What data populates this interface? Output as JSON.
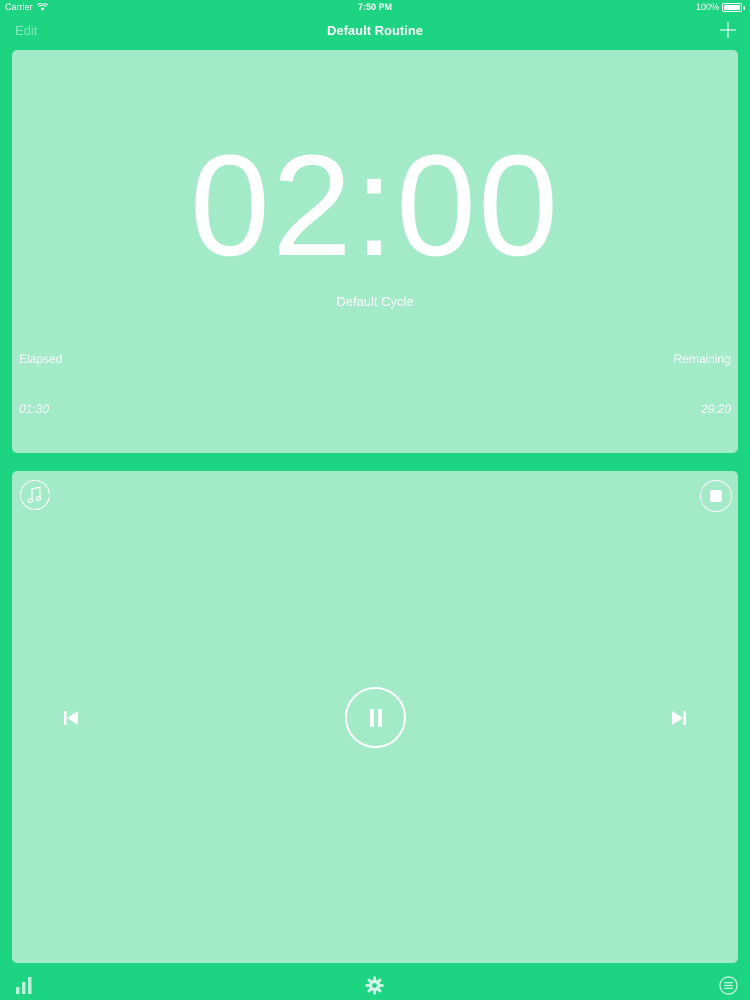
{
  "status_bar": {
    "carrier": "Carrier",
    "time": "7:50 PM",
    "battery": "100%"
  },
  "nav": {
    "edit_label": "Edit",
    "title": "Default Routine"
  },
  "timer": {
    "time": "02:00",
    "cycle_name": "Default Cycle",
    "elapsed_label": "Elapsed",
    "remaining_label": "Remaining",
    "elapsed_value": "01:30",
    "remaining_value": "29:20"
  },
  "player": {
    "music_icon": "music-note-icon",
    "stop_icon": "stop-icon",
    "prev_icon": "skip-previous-icon",
    "pause_icon": "pause-icon",
    "next_icon": "skip-next-icon"
  },
  "tab_bar": {
    "items": [
      "stats-icon",
      "settings-gear-icon",
      "list-icon"
    ]
  },
  "colors": {
    "background": "#1dd483",
    "card": "#a2eac8",
    "foreground": "#ffffff"
  }
}
